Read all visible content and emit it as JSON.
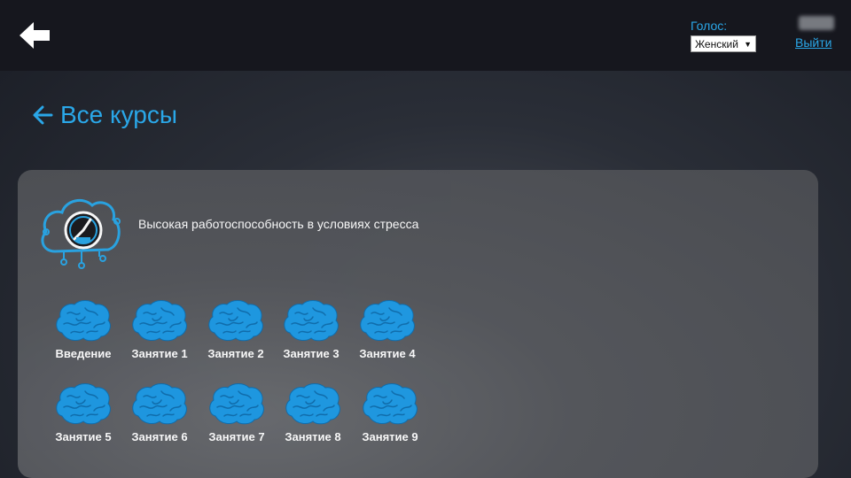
{
  "header": {
    "voice_label": "Голос:",
    "voice_selected": "Женский",
    "user_name": "",
    "logout_label": "Выйти"
  },
  "nav": {
    "all_courses_label": "Все курсы"
  },
  "course": {
    "title": "Высокая работоспособность в условиях стресса",
    "lessons": [
      {
        "label": "Введение"
      },
      {
        "label": "Занятие 1"
      },
      {
        "label": "Занятие 2"
      },
      {
        "label": "Занятие 3"
      },
      {
        "label": "Занятие 4"
      },
      {
        "label": "Занятие 5"
      },
      {
        "label": "Занятие 6"
      },
      {
        "label": "Занятие 7"
      },
      {
        "label": "Занятие 8"
      },
      {
        "label": "Занятие 9"
      }
    ]
  },
  "colors": {
    "accent": "#2aa7e8",
    "brain": "#1e9be6",
    "topbar": "#16171e"
  },
  "icons": {
    "back": "arrow-left-icon",
    "course": "cloud-speedometer-icon",
    "lesson": "brain-icon"
  }
}
